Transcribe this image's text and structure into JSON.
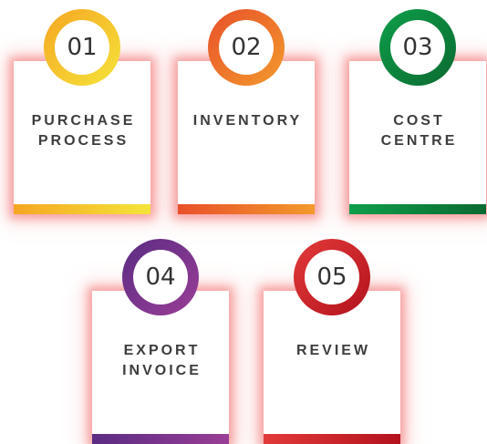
{
  "steps": [
    {
      "number": "01",
      "label": "PURCHASE\nPROCESS",
      "color_start": "#f5a623",
      "color_end": "#f5e43a"
    },
    {
      "number": "02",
      "label": "INVENTORY",
      "color_start": "#e8502a",
      "color_end": "#f39a2c"
    },
    {
      "number": "03",
      "label": "COST\nCENTRE",
      "color_start": "#0e9e4a",
      "color_end": "#0b6a30"
    },
    {
      "number": "04",
      "label": "EXPORT\nINVOICE",
      "color_start": "#5b2c83",
      "color_end": "#9a3e96"
    },
    {
      "number": "05",
      "label": "REVIEW",
      "color_start": "#e23a3a",
      "color_end": "#b3121d"
    }
  ]
}
